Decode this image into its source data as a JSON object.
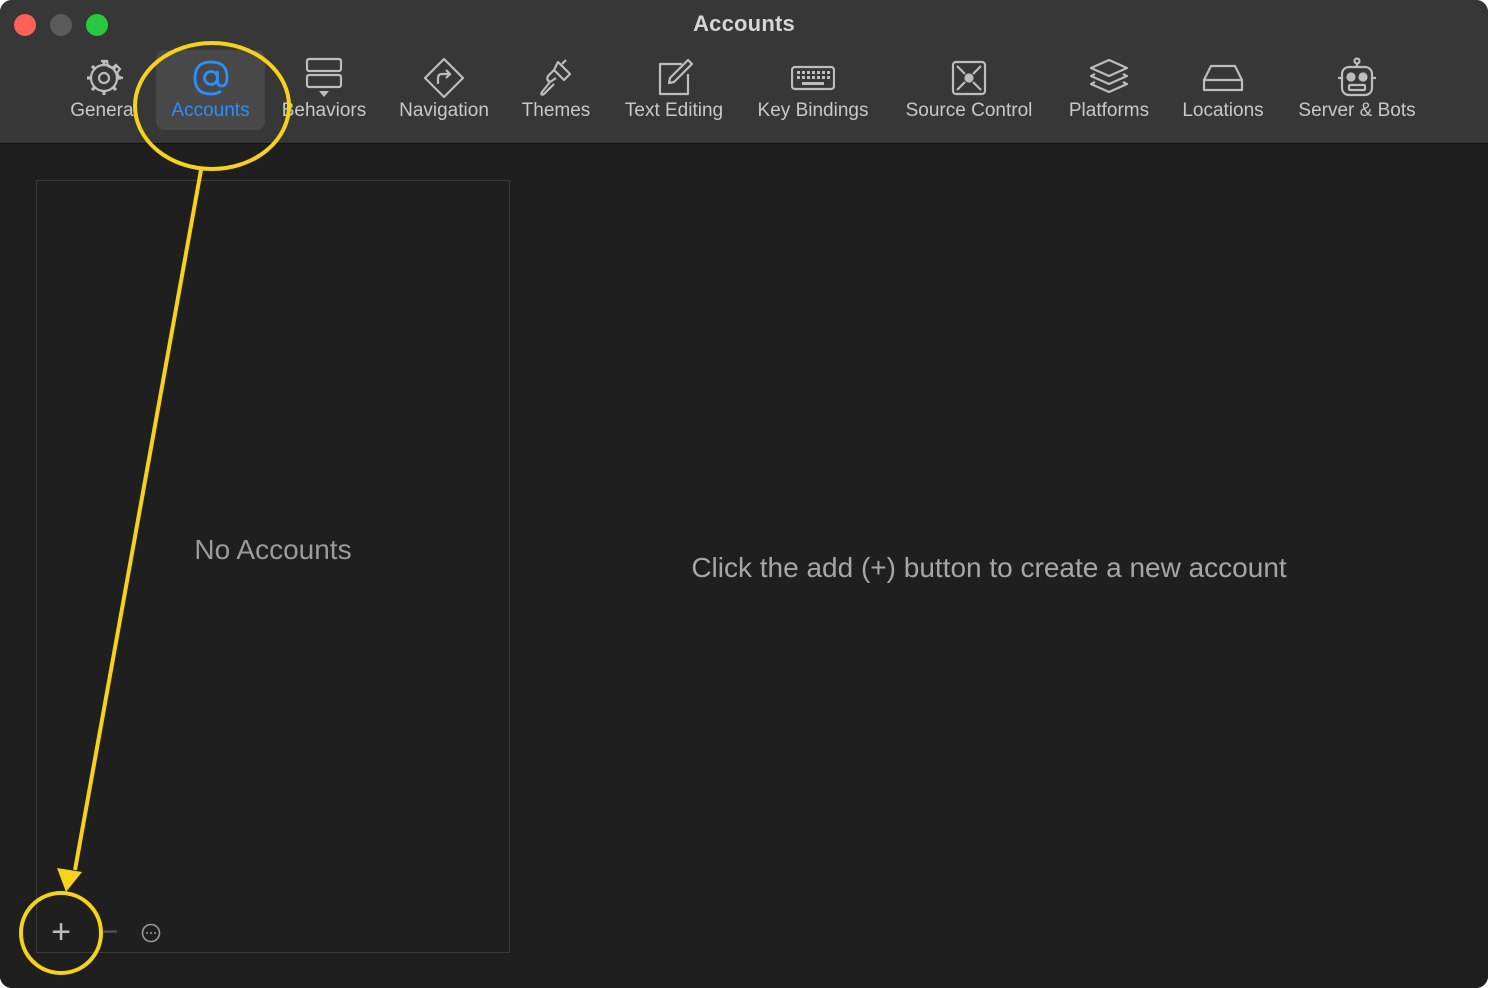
{
  "window": {
    "title": "Accounts"
  },
  "toolbar": {
    "tabs": [
      {
        "label": "General",
        "icon": "gear-icon"
      },
      {
        "label": "Accounts",
        "icon": "at-sign-icon",
        "selected": true
      },
      {
        "label": "Behaviors",
        "icon": "behaviors-icon"
      },
      {
        "label": "Navigation",
        "icon": "navigation-sign-icon"
      },
      {
        "label": "Themes",
        "icon": "paintbrush-icon"
      },
      {
        "label": "Text Editing",
        "icon": "pencil-square-icon"
      },
      {
        "label": "Key Bindings",
        "icon": "keyboard-icon"
      },
      {
        "label": "Source Control",
        "icon": "source-control-icon"
      },
      {
        "label": "Platforms",
        "icon": "layers-icon"
      },
      {
        "label": "Locations",
        "icon": "drive-icon"
      },
      {
        "label": "Server & Bots",
        "icon": "robot-icon"
      }
    ]
  },
  "accounts_list": {
    "empty_text": "No Accounts",
    "add_button": "+",
    "remove_button": "−"
  },
  "detail": {
    "hint": "Click the add (+) button to create a new account"
  },
  "colors": {
    "accent": "#2e8efb",
    "callout": "#f7d21b",
    "window_bg": "#1f1f1f",
    "toolbar_bg": "#373737"
  }
}
